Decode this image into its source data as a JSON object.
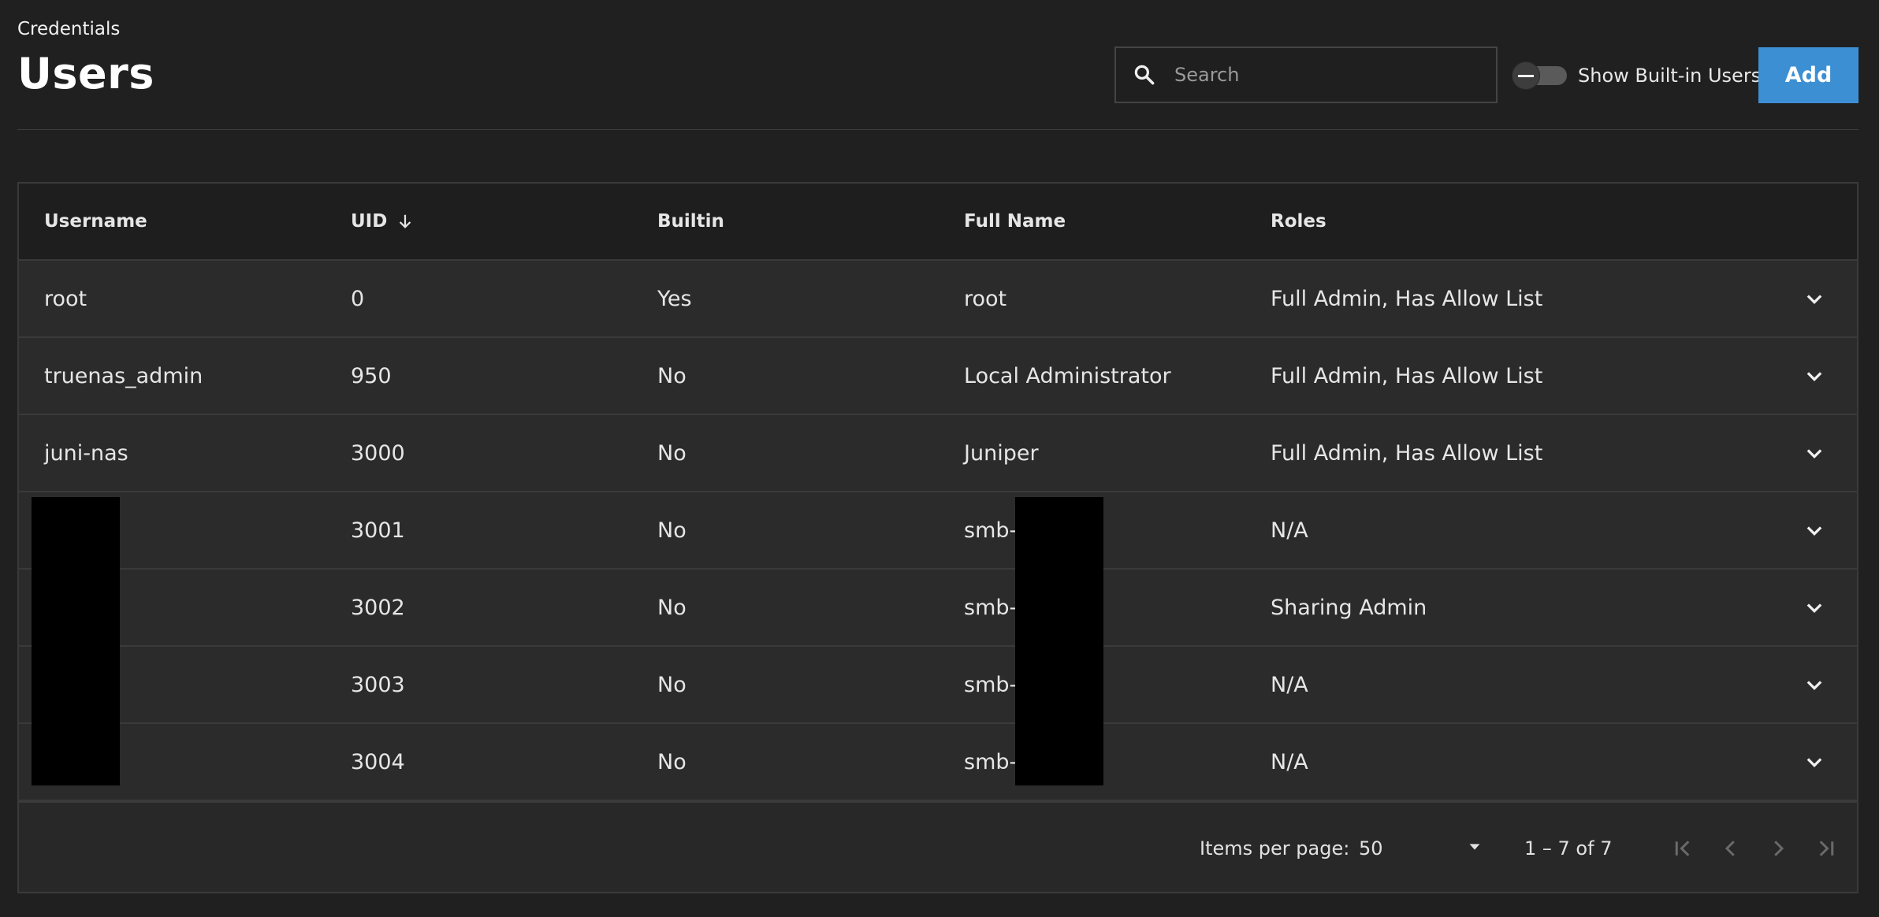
{
  "header": {
    "breadcrumb": "Credentials",
    "title": "Users"
  },
  "search": {
    "placeholder": "Search",
    "value": "",
    "icon": "search-icon"
  },
  "toggle": {
    "label": "Show Built-in Users",
    "checked": false
  },
  "add_button": {
    "label": "Add",
    "color": "#3c8fd3"
  },
  "table": {
    "columns": [
      {
        "label": "Username"
      },
      {
        "label": "UID",
        "sort": "descending-arrow-icon"
      },
      {
        "label": "Builtin"
      },
      {
        "label": "Full Name"
      },
      {
        "label": "Roles"
      }
    ],
    "rows": [
      {
        "username": "root",
        "uid": "0",
        "builtin": "Yes",
        "full_name": "root",
        "roles": "Full Admin, Has Allow List"
      },
      {
        "username": "truenas_admin",
        "uid": "950",
        "builtin": "No",
        "full_name": "Local Administrator",
        "roles": "Full Admin, Has Allow List"
      },
      {
        "username": "juni-nas",
        "uid": "3000",
        "builtin": "No",
        "full_name": "Juniper",
        "roles": "Full Admin, Has Allow List"
      },
      {
        "username": "",
        "uid": "3001",
        "builtin": "No",
        "full_name": "smb-",
        "roles": "N/A"
      },
      {
        "username": "",
        "uid": "3002",
        "builtin": "No",
        "full_name": "smb-",
        "roles": "Sharing Admin"
      },
      {
        "username": "",
        "uid": "3003",
        "builtin": "No",
        "full_name": "smb-",
        "roles": "N/A"
      },
      {
        "username": "",
        "uid": "3004",
        "builtin": "No",
        "full_name": "smb-",
        "roles": "N/A"
      }
    ]
  },
  "paginator": {
    "items_per_page_label": "Items per page:",
    "items_per_page_value": "50",
    "range_label": "1 – 7 of 7"
  }
}
